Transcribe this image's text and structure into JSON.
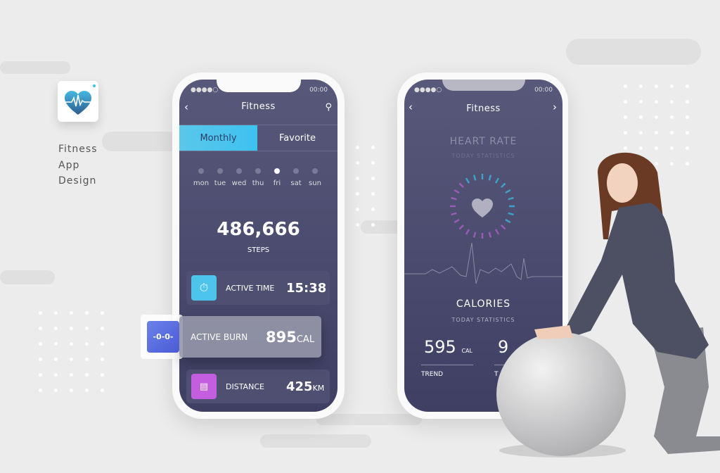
{
  "brand": {
    "lines": [
      "Fitness",
      "App",
      "Design"
    ],
    "icon": "heartbeat-heart-icon",
    "accent": "#3cc2ef"
  },
  "phone1": {
    "status": {
      "signal": "●●●●○",
      "time": "00:00"
    },
    "title": "Fitness",
    "tabs": [
      {
        "label": "Monthly",
        "active": true
      },
      {
        "label": "Favorite",
        "active": false
      }
    ],
    "days": [
      {
        "label": "mon"
      },
      {
        "label": "tue"
      },
      {
        "label": "wed"
      },
      {
        "label": "thu"
      },
      {
        "label": "fri",
        "selected": true
      },
      {
        "label": "sat"
      },
      {
        "label": "sun"
      }
    ],
    "steps": {
      "value": "486,666",
      "label": "STEPS"
    },
    "cards": [
      {
        "label": "ACTIVE TIME",
        "value": "15:38",
        "unit": "",
        "icon": "stopwatch-icon",
        "color": "#4cc4ec"
      },
      {
        "label": "ACTIVE BURN",
        "value": "895",
        "unit": "CAL",
        "icon": "dumbbell-icon",
        "color": "#5b6fe0"
      },
      {
        "label": "DISTANCE",
        "value": "425",
        "unit": "KM",
        "icon": "map-board-icon",
        "color": "#c45ee0"
      }
    ]
  },
  "phone2": {
    "status": {
      "signal": "●●●●○",
      "time": "00:00"
    },
    "title": "Fitness",
    "heart": {
      "title": "HEART RATE",
      "subtitle": "TODAY STATISTICS"
    },
    "calories": {
      "title": "CALORIES",
      "subtitle": "TODAY STATISTICS",
      "stats": [
        {
          "value": "595",
          "unit": "CAL",
          "label": "TREND"
        },
        {
          "value": "9",
          "unit": "",
          "label": "T"
        }
      ]
    }
  }
}
